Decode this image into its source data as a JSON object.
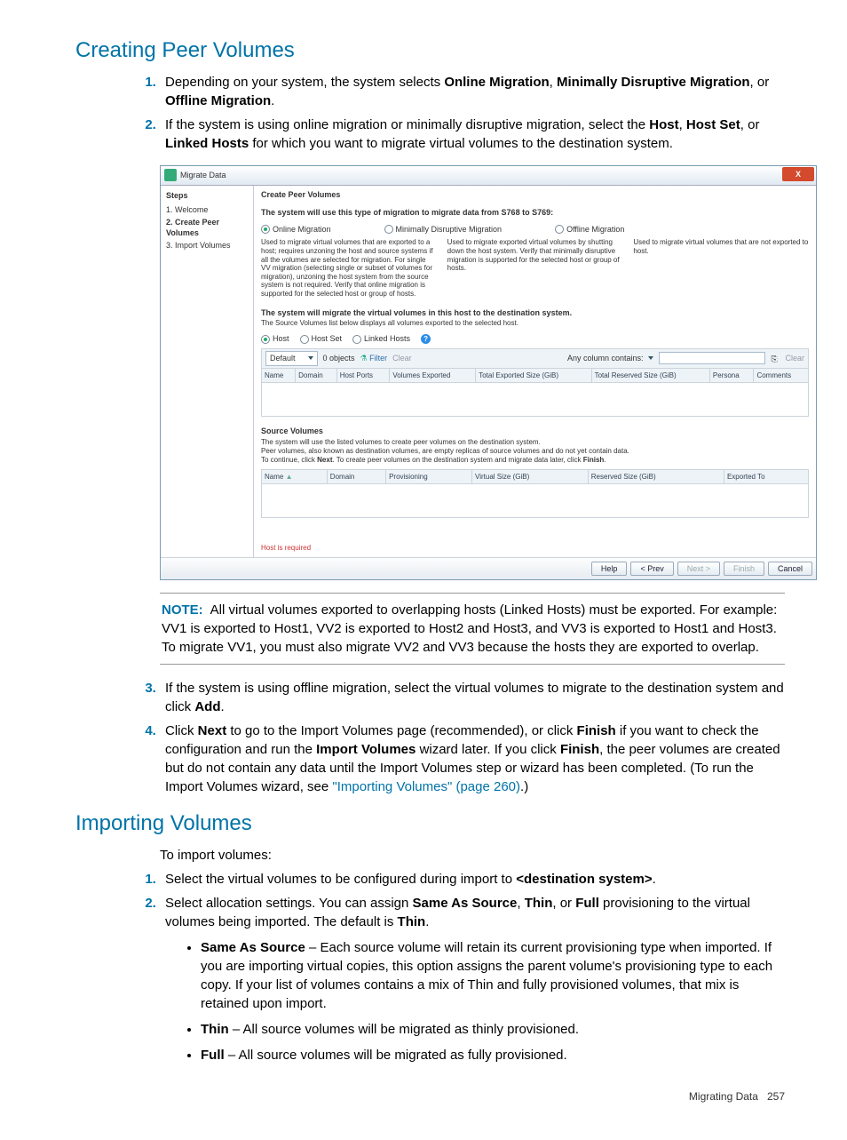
{
  "h_creating": "Creating Peer Volumes",
  "step1_a": "Depending on your system, the system selects ",
  "step1_b": ", ",
  "step1_c": ", or ",
  "step1_d": ".",
  "b_online": "Online Migration",
  "b_mdm": "Minimally Disruptive Migration",
  "b_offline": "Offline Migration",
  "step2_a": "If the system is using online migration or minimally disruptive migration, select the ",
  "step2_b": ", ",
  "step2_c": ", or ",
  "step2_d": " for which you want to migrate virtual volumes to the destination system.",
  "b_host": "Host",
  "b_hostset": "Host Set",
  "b_linked": "Linked Hosts",
  "win": {
    "title": "Migrate Data",
    "steps_hdr": "Steps",
    "s1": "1. Welcome",
    "s2": "2. Create Peer Volumes",
    "s3": "3. Import Volumes",
    "panel_hdr": "Create Peer Volumes",
    "type_line": "The system will use this type of migration to migrate data from S768 to S769:",
    "r_online": "Online Migration",
    "r_mdm": "Minimally Disruptive Migration",
    "r_offline": "Offline Migration",
    "d_online": "Used to migrate virtual volumes that are exported to a host; requires unzoning the host and source systems if all the volumes are selected for migration. For single VV migration (selecting single or subset of volumes for migration), unzoning the host system from the source system is not required. Verify that online migration is supported for the selected host or group of hosts.",
    "d_mdm": "Used to migrate exported virtual volumes by shutting down the host system. Verify that minimally disruptive migration is supported for the selected host or group of hosts.",
    "d_offline": "Used to migrate virtual volumes that are not exported to host.",
    "mig_line1": "The system will migrate the virtual volumes in this host to the destination system.",
    "mig_line2": "The Source Volumes list below displays all volumes exported to the selected host.",
    "r2_host": "Host",
    "r2_hostset": "Host Set",
    "r2_linked": "Linked Hosts",
    "dd_default": "Default",
    "objects": "0 objects",
    "filter": "Filter",
    "clear": "Clear",
    "anycol": "Any column contains:",
    "clear2": "Clear",
    "th1_name": "Name",
    "th1_domain": "Domain",
    "th1_hostports": "Host Ports",
    "th1_volexp": "Volumes Exported",
    "th1_totexp": "Total Exported Size (GiB)",
    "th1_totres": "Total Reserved Size (GiB)",
    "th1_persona": "Persona",
    "th1_comments": "Comments",
    "src_hdr": "Source Volumes",
    "src_l1": "The system will use the listed volumes to create peer volumes on the destination system.",
    "src_l2": "Peer volumes, also known as destination volumes, are empty replicas of source volumes and do not yet contain data.",
    "src_l3_a": "To continue, click ",
    "src_l3_b": ". To create peer volumes on the destination system and migrate data later, click ",
    "src_l3_c": ".",
    "b_next": "Next",
    "b_finish": "Finish",
    "th2_name": "Name",
    "th2_domain": "Domain",
    "th2_prov": "Provisioning",
    "th2_vsize": "Virtual Size (GiB)",
    "th2_rsize": "Reserved Size (GiB)",
    "th2_expto": "Exported To",
    "err": "Host is required",
    "btn_help": "Help",
    "btn_prev": "< Prev",
    "btn_next": "Next >",
    "btn_finish": "Finish",
    "btn_cancel": "Cancel"
  },
  "note_lbl": "NOTE:",
  "note_body": "All virtual volumes exported to overlapping hosts (Linked Hosts) must be exported. For example: VV1 is exported to Host1, VV2 is exported to Host2 and Host3, and VV3 is exported to Host1 and Host3. To migrate VV1, you must also migrate VV2 and VV3 because the hosts they are exported to overlap.",
  "step3_a": "If the system is using offline migration, select the virtual volumes to migrate to the destination system and click ",
  "step3_b": ".",
  "b_add": "Add",
  "step4_a": "Click ",
  "step4_b": " to go to the Import Volumes page (recommended), or click ",
  "step4_c": " if you want to check the configuration and run the ",
  "step4_d": " wizard later. If you click ",
  "step4_e": ", the peer volumes are created but do not contain any data until the Import Volumes step or wizard has been completed. (To run the Import Volumes wizard, see ",
  "step4_f": ".)",
  "b_next2": "Next",
  "b_finish2": "Finish",
  "b_importvol": "Import Volumes",
  "b_finish3": "Finish",
  "link_import": "\"Importing Volumes\" (page 260)",
  "h_importing": "Importing Volumes",
  "intro_import": "To import volumes:",
  "istep1_a": "Select the virtual volumes to be configured during import to ",
  "istep1_b": ".",
  "b_dest": "<destination system>",
  "istep2_a": "Select allocation settings. You can assign ",
  "istep2_b": ", ",
  "istep2_c": ", or ",
  "istep2_d": " provisioning to the virtual volumes being imported. The default is ",
  "istep2_e": ".",
  "b_sas": "Same As Source",
  "b_thin": "Thin",
  "b_full": "Full",
  "b_thin2": "Thin",
  "bul1_a": "Same As Source",
  "bul1_b": " – Each source volume will retain its current provisioning type when imported. If you are importing virtual copies, this option assigns the parent volume's provisioning type to each copy. If your list of volumes contains a mix of Thin and fully provisioned volumes, that mix is retained upon import.",
  "bul2_a": "Thin",
  "bul2_b": " – All source volumes will be migrated as thinly provisioned.",
  "bul3_a": "Full",
  "bul3_b": " – All source volumes will be migrated as fully provisioned.",
  "footer_a": "Migrating Data",
  "footer_b": "257"
}
